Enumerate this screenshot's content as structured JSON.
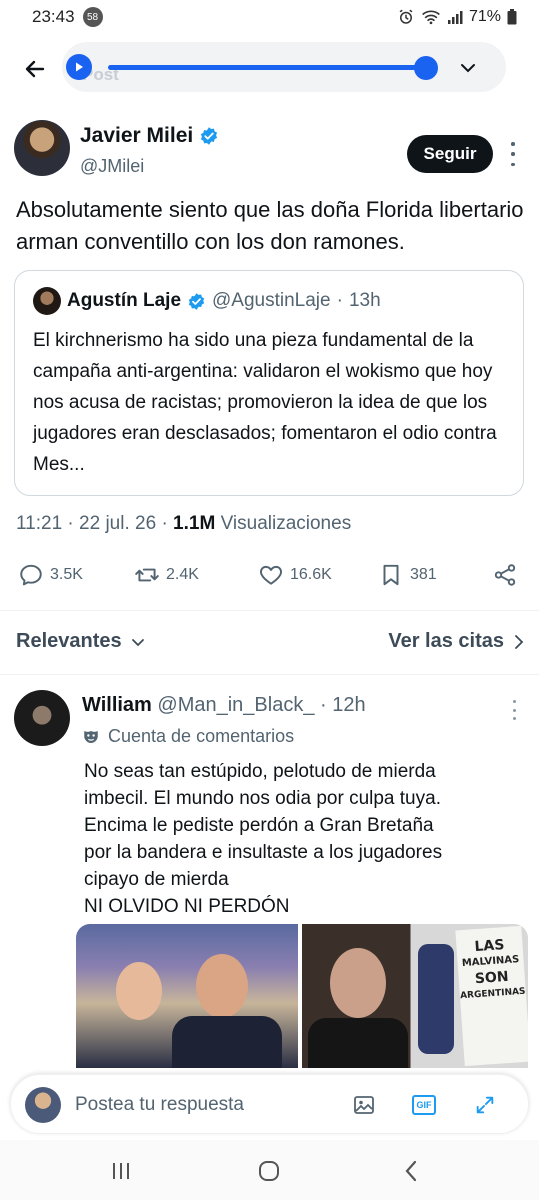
{
  "status": {
    "time": "23:43",
    "notif_count": "58",
    "battery": "71%"
  },
  "header": {
    "post_label": "Post"
  },
  "author": {
    "name": "Javier Milei",
    "handle": "@JMilei",
    "follow_label": "Seguir"
  },
  "tweet": {
    "text": "Absolutamente siento que las doña Florida libertario arman conventillo con los don ramones."
  },
  "quote": {
    "name": "Agustín Laje",
    "handle": "@AgustinLaje",
    "sep": "·",
    "age": "13h",
    "text": "El kirchnerismo ha sido una pieza fundamental de la campaña anti-argentina: validaron el wokismo que hoy nos acusa de racistas; promovieron la idea de que los jugadores eran desclasados; fomentaron el odio contra Mes..."
  },
  "meta": {
    "time": "11:21",
    "sep1": "·",
    "date": "22 jul. 26",
    "sep2": "·",
    "views_count": "1.1M",
    "views_label": "Visualizaciones"
  },
  "actions": {
    "replies": "3.5K",
    "reposts": "2.4K",
    "likes": "16.6K",
    "bookmarks": "381"
  },
  "filters": {
    "sort_label": "Relevantes",
    "quotes_label": "Ver las citas"
  },
  "reply": {
    "name": "William",
    "handle": "@Man_in_Black_",
    "sep": "·",
    "age": "12h",
    "community": "Cuenta de comentarios",
    "lines": [
      "No seas tan estúpido, pelotudo de mierda",
      "imbecil. El mundo nos odia por culpa tuya.",
      "Encima le pediste perdón a Gran Bretaña",
      "por la bandera e insultaste a los jugadores",
      "cipayo de mierda",
      "NI OLVIDO NI PERDÓN"
    ],
    "banner_text": [
      "LAS",
      "MALVINAS",
      "SON",
      "ARGENTINAS"
    ]
  },
  "composer": {
    "placeholder": "Postea tu respuesta",
    "gif_label": "GIF"
  },
  "colors": {
    "accent": "#1d9bf0",
    "player_blue": "#1a62f0",
    "text": "#0f1419",
    "muted": "#536471"
  }
}
